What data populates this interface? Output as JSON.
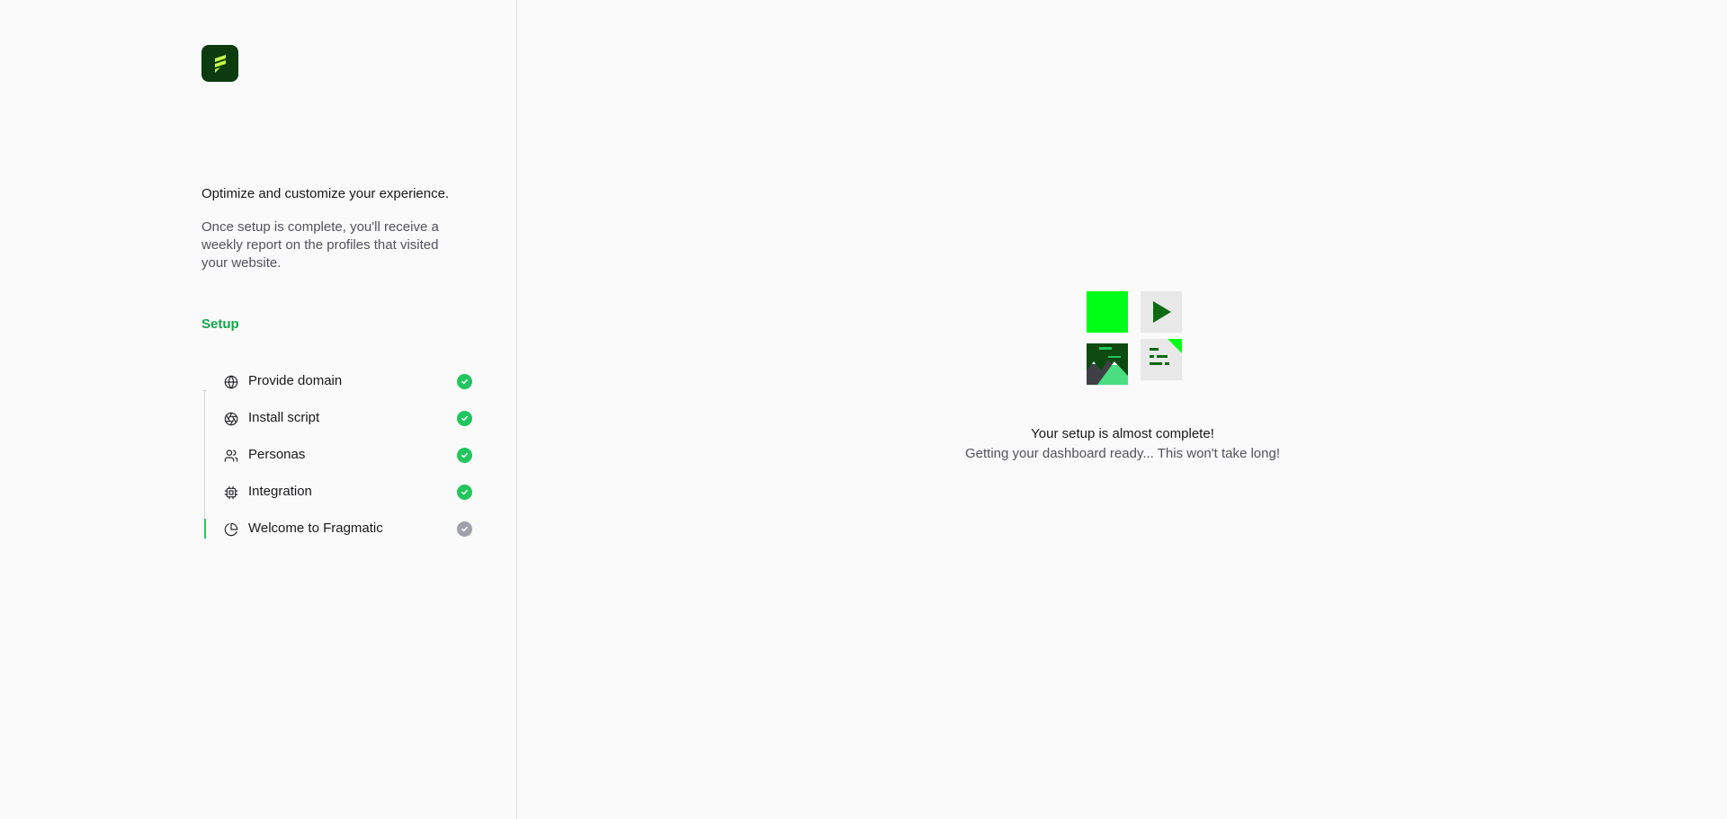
{
  "sidebar": {
    "logo_name": "fragmatic-logo",
    "intro_title": "Optimize and customize your experience.",
    "intro_description": "Once setup is complete, you'll receive a weekly report on the profiles that visited your website.",
    "section_label": "Setup",
    "steps": [
      {
        "label": "Provide domain",
        "icon": "globe-icon",
        "status": "complete"
      },
      {
        "label": "Install script",
        "icon": "aperture-icon",
        "status": "complete"
      },
      {
        "label": "Personas",
        "icon": "users-icon",
        "status": "complete"
      },
      {
        "label": "Integration",
        "icon": "chip-icon",
        "status": "complete"
      },
      {
        "label": "Welcome to Fragmatic",
        "icon": "pie-chart-icon",
        "status": "pending"
      }
    ]
  },
  "main": {
    "status_title": "Your setup is almost complete!",
    "status_subtitle": "Getting your dashboard ready... This won't take long!"
  },
  "colors": {
    "accent": "#22c55e",
    "section_label": "#16a34a",
    "logo_bg": "#0c3b0f",
    "tile_bright": "#00ff18",
    "tile_dark": "#0c4a10",
    "pending": "#a1a1aa"
  }
}
